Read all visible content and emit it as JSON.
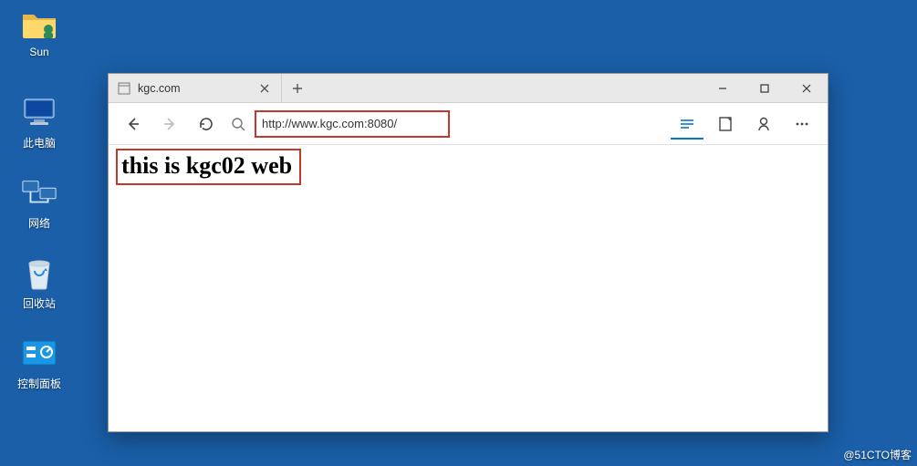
{
  "desktop": {
    "icons": [
      {
        "name": "sun-folder",
        "label": "Sun"
      },
      {
        "name": "this-pc",
        "label": "此电脑"
      },
      {
        "name": "network",
        "label": "网络"
      },
      {
        "name": "recycle-bin",
        "label": "回收站"
      },
      {
        "name": "control-panel",
        "label": "控制面板"
      }
    ]
  },
  "browser": {
    "tab": {
      "title": "kgc.com"
    },
    "newtab_tooltip": "New tab",
    "window": {
      "minimize": "–",
      "maximize": "▢",
      "close": "✕"
    },
    "nav": {
      "back": "←",
      "forward": "→",
      "refresh": "↻"
    },
    "address": {
      "value": "http://www.kgc.com:8080/"
    },
    "right": {
      "reading_view": "Reading view",
      "notes": "Notes",
      "share": "Share",
      "more": "More"
    }
  },
  "page": {
    "heading": "this is kgc02 web"
  },
  "watermark": "@51CTO博客"
}
